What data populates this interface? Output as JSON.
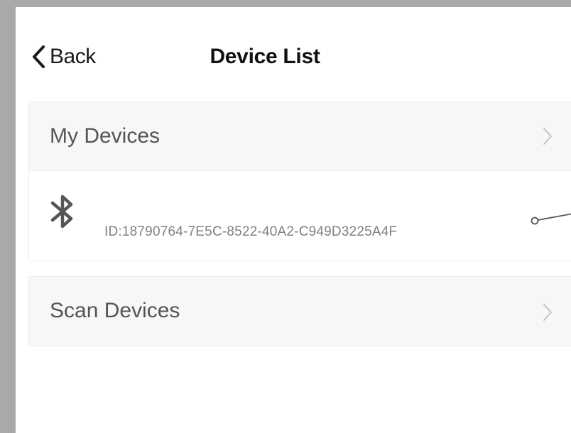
{
  "nav": {
    "back_label": "Back",
    "title": "Device List"
  },
  "rows": {
    "my_devices": {
      "label": "My Devices"
    },
    "device": {
      "id_text": "ID:18790764-7E5C-8522-40A2-C949D3225A4F"
    },
    "scan_devices": {
      "label": "Scan Devices"
    }
  },
  "icons": {
    "back": "chevron-left-icon",
    "row_arrow": "chevron-right-icon",
    "device": "bluetooth-icon",
    "connector": "connector-line-icon"
  },
  "colors": {
    "text_primary": "#111111",
    "text_secondary": "#555555",
    "text_muted": "#808080",
    "row_background": "#f7f7f7",
    "outer_background": "#a9a9a9"
  }
}
